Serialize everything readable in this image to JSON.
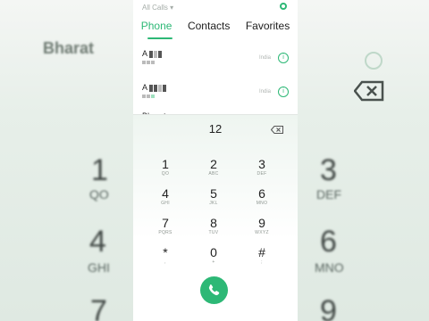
{
  "status": {
    "label": "All Calls"
  },
  "tabs": [
    {
      "label": "Phone"
    },
    {
      "label": "Contacts"
    },
    {
      "label": "Favorites"
    }
  ],
  "recents": [
    {
      "name": "A",
      "location": "India"
    },
    {
      "name": "A",
      "location": "India"
    },
    {
      "name": "Bharat ",
      "location": ""
    }
  ],
  "dialer": {
    "display": "12",
    "keys": [
      {
        "digit": "1",
        "letters": "QO"
      },
      {
        "digit": "2",
        "letters": "ABC"
      },
      {
        "digit": "3",
        "letters": "DEF"
      },
      {
        "digit": "4",
        "letters": "GHI"
      },
      {
        "digit": "5",
        "letters": "JKL"
      },
      {
        "digit": "6",
        "letters": "MNO"
      },
      {
        "digit": "7",
        "letters": "PQRS"
      },
      {
        "digit": "8",
        "letters": "TUV"
      },
      {
        "digit": "9",
        "letters": "WXYZ"
      },
      {
        "digit": "*",
        "letters": ","
      },
      {
        "digit": "0",
        "letters": "+"
      },
      {
        "digit": "#",
        "letters": ";"
      }
    ]
  },
  "background": {
    "name_text": "Bharat",
    "left_digits": [
      "1",
      "4",
      "7"
    ],
    "left_letters": [
      "QO",
      "GHI"
    ],
    "right_digits": [
      "3",
      "6",
      "9"
    ],
    "right_letters": [
      "DEF",
      "MNO"
    ]
  },
  "colors": {
    "accent": "#2db876"
  }
}
